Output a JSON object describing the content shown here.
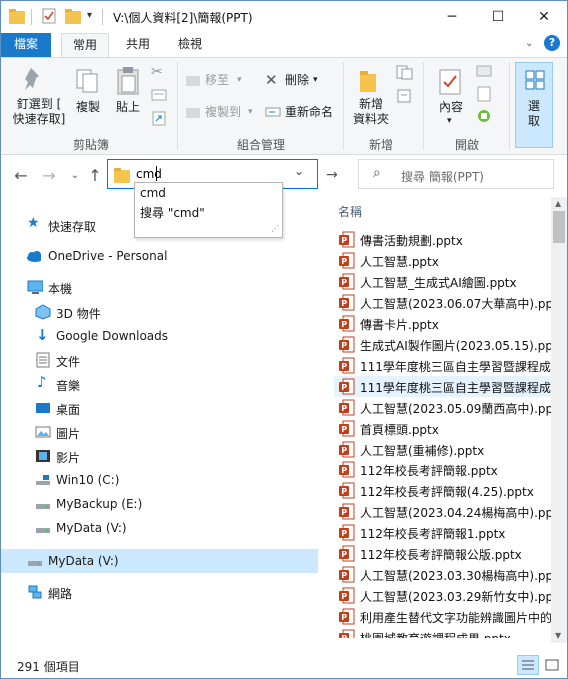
{
  "window": {
    "title": "V:\\個人資料[2]\\簡報(PPT)",
    "min_label": "─",
    "max_label": "☐",
    "close_label": "✕"
  },
  "tabs": [
    {
      "label": "檔案"
    },
    {
      "label": "常用"
    },
    {
      "label": "共用"
    },
    {
      "label": "檢視"
    }
  ],
  "ribbon": {
    "pin_label": "釘選到 [\n快速存取]",
    "copy_label": "複製",
    "paste_label": "貼上",
    "move_to_label": "移至",
    "copy_to_label": "複製到",
    "delete_label": "刪除",
    "rename_label": "重新命名",
    "new_folder_label": "新增\n資料夾",
    "properties_label": "內容",
    "select_label": "選\n取",
    "groups": {
      "clipboard": "剪貼簿",
      "organize": "組合管理",
      "new": "新增",
      "open": "開啟"
    }
  },
  "address": {
    "value": "cmd"
  },
  "search": {
    "placeholder": "搜尋 簡報(PPT)"
  },
  "autocomplete": [
    {
      "label": "cmd"
    },
    {
      "label": "搜尋 \"cmd\""
    }
  ],
  "nav": {
    "quick_access": "快速存取",
    "onedrive": "OneDrive - Personal",
    "this_pc": "本機",
    "objects3d": "3D 物件",
    "downloads": "Google Downloads",
    "documents": "文件",
    "music": "音樂",
    "desktop": "桌面",
    "pictures": "圖片",
    "videos": "影片",
    "drive_c": "Win10 (C:)",
    "drive_e": "MyBackup (E:)",
    "drive_v": "MyData (V:)",
    "drive_v_root": "MyData (V:)",
    "network": "網路"
  },
  "files": {
    "column_name": "名稱",
    "items": [
      "傳書活動規劃.pptx",
      "人工智慧.pptx",
      "人工智慧_生成式AI繪圖.pptx",
      "人工智慧(2023.06.07大華高中).pptx",
      "傳書卡片.pptx",
      "生成式AI製作圖片(2023.05.15).pptx",
      "111學年度桃三區自主學習暨課程成果",
      "111學年度桃三區自主學習暨課程成果",
      "人工智慧(2023.05.09蘭西高中).pptx",
      "首頁標頭.pptx",
      "人工智慧(重補修).pptx",
      "112年校長考評簡報.pptx",
      "112年校長考評簡報(4.25).pptx",
      "人工智慧(2023.04.24楊梅高中).pptx",
      "112年校長考評簡報1.pptx",
      "112年校長考評簡報公版.pptx",
      "人工智慧(2023.03.30楊梅高中).pptx",
      "人工智慧(2023.03.29新竹女中).pptx",
      "利用產生替代文字功能辨識圖片中的",
      "桃園城教育遊課程成果.pptx"
    ]
  },
  "status": {
    "count": "291 個項目"
  },
  "colors": {
    "file_tab": "#1979ca",
    "accent": "#0078d7",
    "selection": "#cce8ff",
    "folder": "#f4c44e",
    "ppt": "#c43e1c"
  }
}
